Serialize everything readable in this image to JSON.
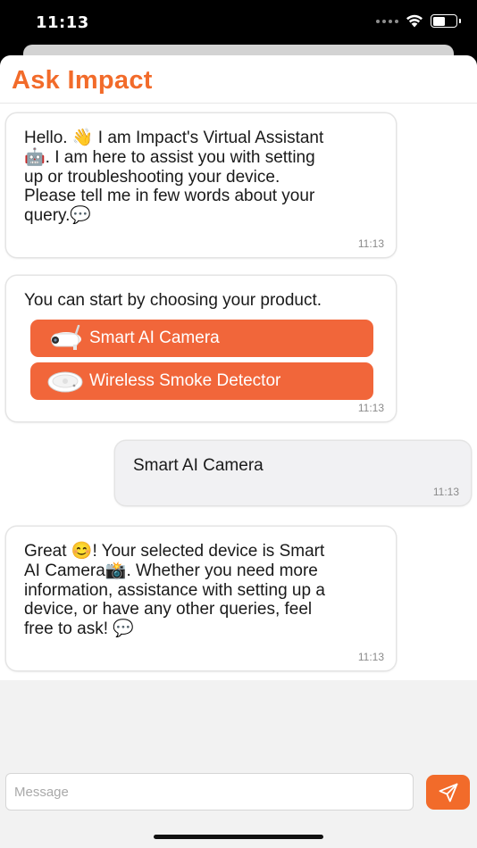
{
  "status_bar": {
    "time": "11:13"
  },
  "header": {
    "title": "Ask Impact"
  },
  "messages": [
    {
      "sender": "bot",
      "lines": [
        "Hello. 👋 I am Impact's Virtual Assistant",
        "🤖. I am here to assist you with setting",
        "up or troubleshooting your device.",
        "Please tell me in few words about your",
        "query.💬"
      ],
      "time": "11:13"
    },
    {
      "sender": "bot",
      "text": "You can start by choosing your product.",
      "choices": [
        {
          "label": "Smart AI Camera",
          "icon": "camera-icon"
        },
        {
          "label": "Wireless Smoke Detector",
          "icon": "smoke-detector-icon"
        }
      ],
      "time": "11:13"
    },
    {
      "sender": "user",
      "text": "Smart AI Camera",
      "time": "11:13"
    },
    {
      "sender": "bot",
      "lines": [
        "Great 😊!  Your selected device is Smart",
        "AI Camera📸. Whether you need more",
        "information, assistance with setting up a",
        "device, or have any other queries, feel",
        "free to ask! 💬"
      ],
      "time": "11:13"
    }
  ],
  "composer": {
    "placeholder": "Message",
    "send_icon": "send-icon"
  },
  "colors": {
    "accent": "#f26b2a",
    "button": "#f1663a",
    "user_bubble": "#f1f1f3"
  }
}
